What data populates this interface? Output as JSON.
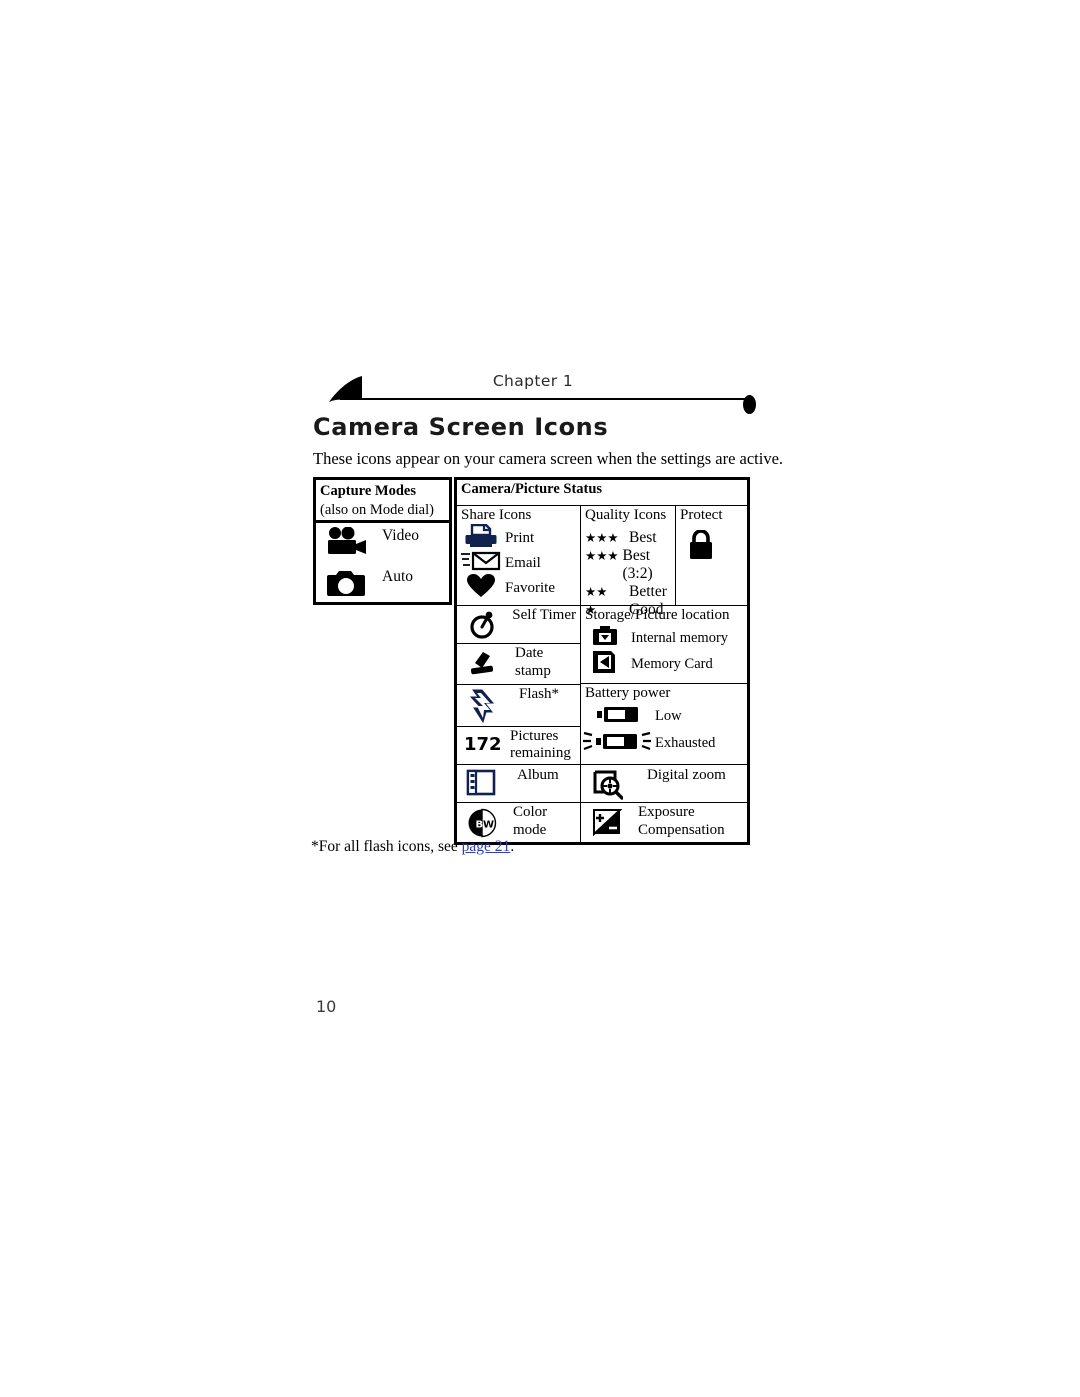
{
  "header": {
    "chapter_label": "Chapter 1",
    "title": "Camera Screen Icons",
    "intro": "These icons appear on your camera screen when the settings are active."
  },
  "table": {
    "capture_modes": {
      "title": "Capture Modes",
      "subtitle": "(also on Mode dial)",
      "items": [
        {
          "icon": "video-camera-icon",
          "label": "Video"
        },
        {
          "icon": "still-camera-icon",
          "label": "Auto"
        }
      ]
    },
    "status": {
      "title": "Camera/Picture Status",
      "share": {
        "heading": "Share Icons",
        "items": [
          {
            "icon": "printer-icon",
            "label": "Print"
          },
          {
            "icon": "envelope-icon",
            "label": "Email"
          },
          {
            "icon": "heart-icon",
            "label": "Favorite"
          }
        ]
      },
      "quality": {
        "heading": "Quality Icons",
        "items": [
          {
            "stars": "★★★",
            "label": "Best"
          },
          {
            "stars": "★★★",
            "label": "Best (3:2)"
          },
          {
            "stars": "★★",
            "label": "Better"
          },
          {
            "stars": "★",
            "label": "Good"
          }
        ]
      },
      "protect": {
        "heading": "Protect",
        "icon": "padlock-icon"
      },
      "self_timer": {
        "icon": "self-timer-icon",
        "label": "Self Timer"
      },
      "date_stamp": {
        "icon": "date-stamp-icon",
        "label_line1": "Date",
        "label_line2": "stamp"
      },
      "flash": {
        "icon": "flash-icon",
        "label": "Flash*"
      },
      "pictures_remaining": {
        "value": "172",
        "label_line1": "Pictures",
        "label_line2": "remaining"
      },
      "album": {
        "icon": "album-icon",
        "label": "Album"
      },
      "color_mode": {
        "icon": "color-mode-icon",
        "label_line1": "Color",
        "label_line2": "mode"
      },
      "storage": {
        "heading": "Storage/Picture location",
        "items": [
          {
            "icon": "internal-memory-icon",
            "label": "Internal memory"
          },
          {
            "icon": "memory-card-icon",
            "label": "Memory Card"
          }
        ]
      },
      "battery": {
        "heading": "Battery power",
        "items": [
          {
            "icon": "battery-low-icon",
            "label": "Low"
          },
          {
            "icon": "battery-exhausted-icon",
            "label": "Exhausted"
          }
        ]
      },
      "digital_zoom": {
        "icon": "digital-zoom-icon",
        "label": "Digital zoom"
      },
      "exposure_compensation": {
        "icon": "exposure-compensation-icon",
        "label_line1": "Exposure",
        "label_line2": "Compensation"
      }
    }
  },
  "footnote": {
    "prefix": "*For all flash icons, see ",
    "link": "page 21",
    "suffix": "."
  },
  "page_number": "10",
  "colors": {
    "ink": "#000000",
    "navy": "#12224f",
    "link": "#2f3fb0"
  }
}
